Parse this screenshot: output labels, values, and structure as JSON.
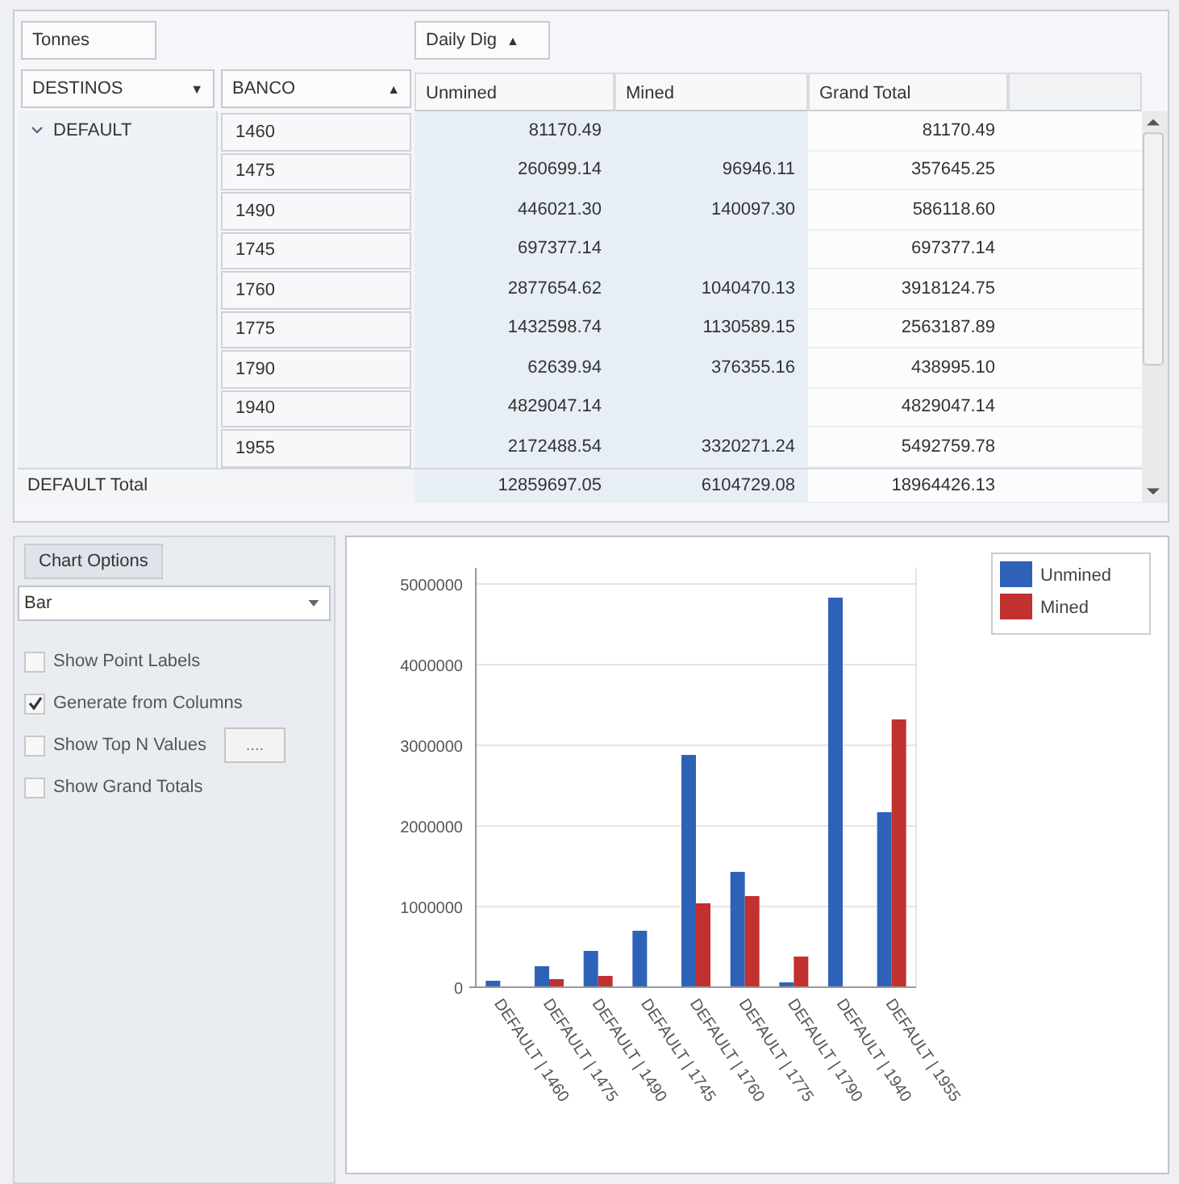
{
  "pivot": {
    "filter_fields": [
      "Tonnes"
    ],
    "column_field": {
      "label": "Daily Dig",
      "arrow": "▲"
    },
    "row_fields": [
      {
        "label": "DESTINOS",
        "arrow": "▼"
      },
      {
        "label": "BANCO",
        "arrow": "▲"
      }
    ],
    "columns": [
      "Unmined",
      "Mined",
      "Grand Total"
    ],
    "group": {
      "label": "DEFAULT",
      "expanded": true
    },
    "rows": [
      {
        "banco": "1460",
        "unmined": "81170.49",
        "grand_total": "81170.49"
      },
      {
        "banco": "1475",
        "unmined": "260699.14",
        "mined": "96946.11",
        "grand_total": "357645.25"
      },
      {
        "banco": "1490",
        "unmined": "446021.30",
        "mined": "140097.30",
        "grand_total": "586118.60"
      },
      {
        "banco": "1745",
        "unmined": "697377.14",
        "grand_total": "697377.14"
      },
      {
        "banco": "1760",
        "unmined": "2877654.62",
        "mined": "1040470.13",
        "grand_total": "3918124.75"
      },
      {
        "banco": "1775",
        "unmined": "1432598.74",
        "mined": "1130589.15",
        "grand_total": "2563187.89"
      },
      {
        "banco": "1790",
        "unmined": "62639.94",
        "mined": "376355.16",
        "grand_total": "438995.10"
      },
      {
        "banco": "1940",
        "unmined": "4829047.14",
        "grand_total": "4829047.14"
      },
      {
        "banco": "1955",
        "unmined": "2172488.54",
        "mined": "3320271.24",
        "grand_total": "5492759.78"
      }
    ],
    "total": {
      "label": "DEFAULT Total",
      "unmined": "12859697.05",
      "mined": "6104729.08",
      "grand_total": "18964426.13"
    }
  },
  "chart_options": {
    "title": "Chart Options",
    "chart_type": "Bar",
    "options": [
      {
        "label": "Show Point Labels",
        "checked": false
      },
      {
        "label": "Generate from Columns",
        "checked": true
      },
      {
        "label": "Show Top N Values",
        "checked": false,
        "button": "...."
      },
      {
        "label": "Show Grand Totals",
        "checked": false
      }
    ]
  },
  "chart": {
    "chart_data": {
      "type": "bar",
      "grid": true,
      "legend": true,
      "categories": [
        "DEFAULT | 1460",
        "DEFAULT | 1475",
        "DEFAULT | 1490",
        "DEFAULT | 1745",
        "DEFAULT | 1760",
        "DEFAULT | 1775",
        "DEFAULT | 1790",
        "DEFAULT | 1940",
        "DEFAULT | 1955"
      ],
      "series": [
        {
          "name": "Unmined",
          "color": "#2e62b8",
          "values": [
            80000,
            260000,
            450000,
            700000,
            2880000,
            1430000,
            60000,
            4830000,
            2170000
          ]
        },
        {
          "name": "Mined",
          "color": "#c0312f",
          "values": [
            null,
            100000,
            140000,
            null,
            1040000,
            1130000,
            380000,
            null,
            3320000
          ]
        }
      ],
      "ylim": [
        0,
        5000000
      ],
      "yticks": [
        0,
        1000000,
        2000000,
        3000000,
        4000000,
        5000000
      ]
    }
  }
}
